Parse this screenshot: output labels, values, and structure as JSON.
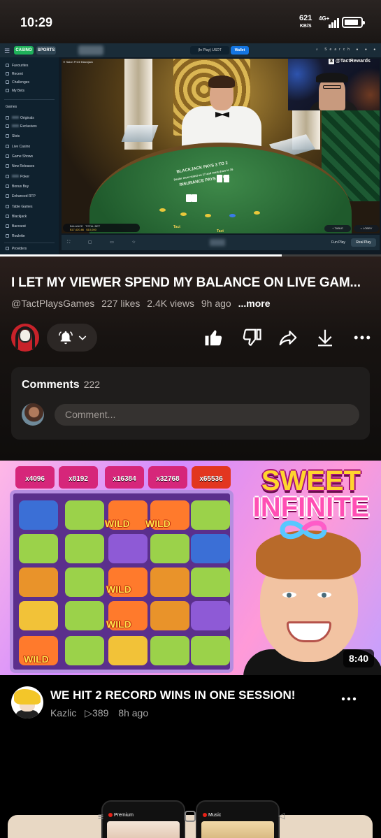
{
  "status_bar": {
    "time": "10:29",
    "speed": "621",
    "speed_unit": "KB/S",
    "network": "4G+",
    "battery_icon": "battery-icon"
  },
  "player": {
    "site": {
      "casino_tab": "CASINO",
      "sports_tab": "SPORTS",
      "balance_select": "(In Play)  USDT",
      "wallet_button": "Wallet",
      "search_label": "Search",
      "sidebar_items": [
        "Favourites",
        "Recent",
        "Challenges",
        "My Bets"
      ],
      "games_heading": "Games",
      "game_items": [
        "Originals",
        "Exclusives",
        "Slots",
        "Live Casino",
        "Game Shows",
        "New Releases",
        "Poker",
        "Bonus Buy",
        "Enhanced RTP",
        "Table Games",
        "Blackjack",
        "Baccarat",
        "Roulette"
      ],
      "providers_item": "Providers"
    },
    "game": {
      "title": "Salon Privé Blackjack",
      "felt_line1": "BLACKJACK PAYS 3 TO 2",
      "felt_line2": "Dealer must stand on 17 and must draw to 16",
      "felt_line3": "INSURANCE PAYS 2 TO 1",
      "balance_label": "BALANCE",
      "balance_value": "$17,420.86",
      "total_bet_label": "TOTAL BET",
      "total_bet_value": "$10,000",
      "watermark": "Tact",
      "table_button": "TABLE",
      "lobby_button": "LOBBY",
      "fun_play": "Fun Play",
      "real_play": "Real Play"
    },
    "webcam_handle": "@TactRewards",
    "progress": 0.74
  },
  "video": {
    "title": "I LET MY VIEWER SPEND MY BALANCE ON LIVE GAM...",
    "channel": "@TactPlaysGames",
    "likes": "227 likes",
    "views": "2.4K views",
    "ago": "9h ago",
    "more": "...more"
  },
  "actions": {
    "subscribe_icon": "bell-icon",
    "like_icon": "thumbs-up-icon",
    "dislike_icon": "thumbs-down-icon",
    "share_icon": "share-icon",
    "download_icon": "download-icon",
    "more_icon": "more-icon"
  },
  "comments": {
    "title": "Comments",
    "count": "222",
    "placeholder": "Comment..."
  },
  "next_video": {
    "thumbnail_title_line1": "SWEET",
    "thumbnail_title_line2": "INFINITE",
    "multipliers": [
      "x4096",
      "x8192",
      "x16384",
      "x32768",
      "x65536"
    ],
    "wild_label": "WILD",
    "duration": "8:40",
    "title": "WE HIT 2 RECORD WINS IN ONE SESSION!",
    "channel": "Kazlic",
    "views": "389",
    "ago": "8h ago"
  },
  "bottom_previews": {
    "left_label": "Premium",
    "right_label": "Music"
  },
  "colors": {
    "stake_green": "#1fb15a",
    "wallet_blue": "#1475e1",
    "card_bg": "#1f1d1c",
    "youtube_red": "#e62117"
  }
}
